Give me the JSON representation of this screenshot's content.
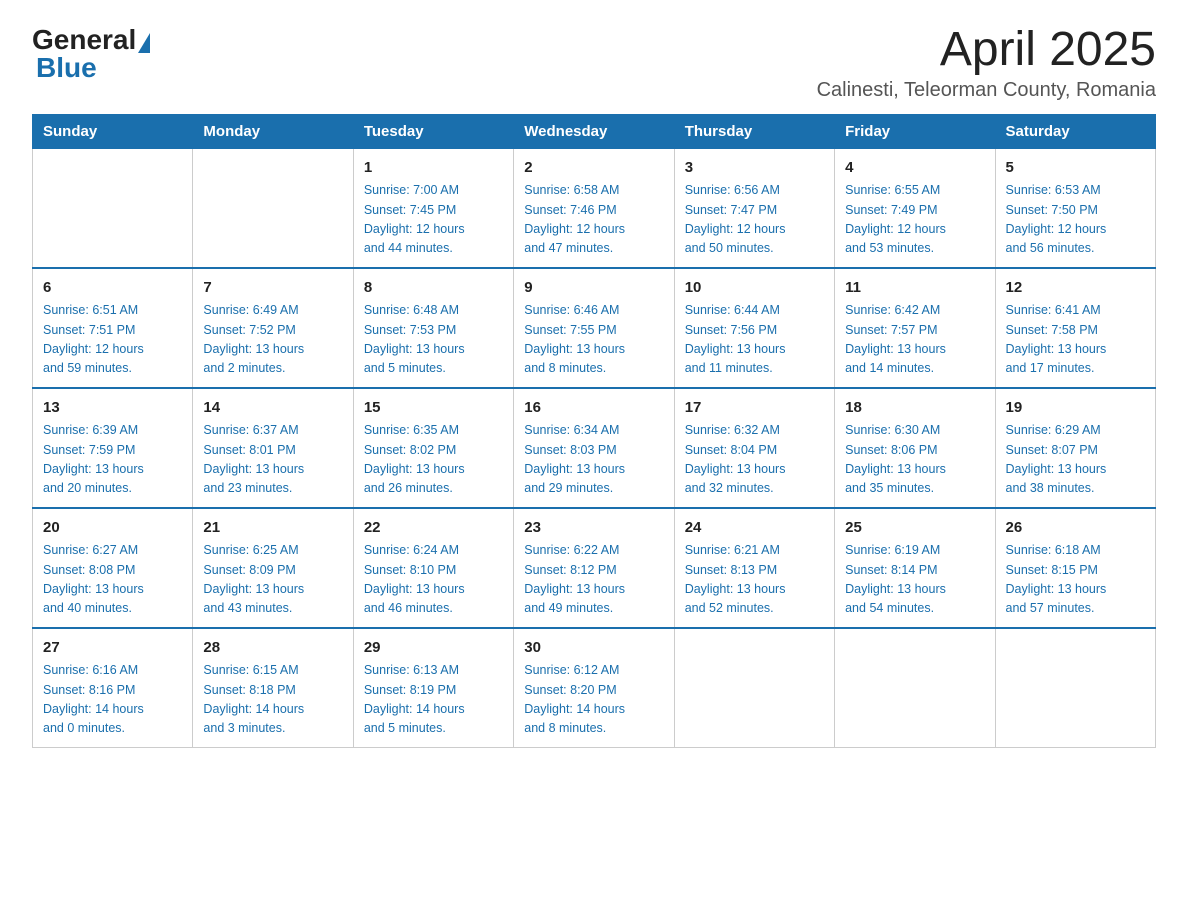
{
  "header": {
    "logo": {
      "text_general": "General",
      "text_blue": "Blue",
      "logo_label": "GeneralBlue"
    },
    "title": "April 2025",
    "subtitle": "Calinesti, Teleorman County, Romania"
  },
  "calendar": {
    "days_of_week": [
      "Sunday",
      "Monday",
      "Tuesday",
      "Wednesday",
      "Thursday",
      "Friday",
      "Saturday"
    ],
    "weeks": [
      {
        "days": [
          {
            "number": "",
            "info": ""
          },
          {
            "number": "",
            "info": ""
          },
          {
            "number": "1",
            "info": "Sunrise: 7:00 AM\nSunset: 7:45 PM\nDaylight: 12 hours\nand 44 minutes."
          },
          {
            "number": "2",
            "info": "Sunrise: 6:58 AM\nSunset: 7:46 PM\nDaylight: 12 hours\nand 47 minutes."
          },
          {
            "number": "3",
            "info": "Sunrise: 6:56 AM\nSunset: 7:47 PM\nDaylight: 12 hours\nand 50 minutes."
          },
          {
            "number": "4",
            "info": "Sunrise: 6:55 AM\nSunset: 7:49 PM\nDaylight: 12 hours\nand 53 minutes."
          },
          {
            "number": "5",
            "info": "Sunrise: 6:53 AM\nSunset: 7:50 PM\nDaylight: 12 hours\nand 56 minutes."
          }
        ]
      },
      {
        "days": [
          {
            "number": "6",
            "info": "Sunrise: 6:51 AM\nSunset: 7:51 PM\nDaylight: 12 hours\nand 59 minutes."
          },
          {
            "number": "7",
            "info": "Sunrise: 6:49 AM\nSunset: 7:52 PM\nDaylight: 13 hours\nand 2 minutes."
          },
          {
            "number": "8",
            "info": "Sunrise: 6:48 AM\nSunset: 7:53 PM\nDaylight: 13 hours\nand 5 minutes."
          },
          {
            "number": "9",
            "info": "Sunrise: 6:46 AM\nSunset: 7:55 PM\nDaylight: 13 hours\nand 8 minutes."
          },
          {
            "number": "10",
            "info": "Sunrise: 6:44 AM\nSunset: 7:56 PM\nDaylight: 13 hours\nand 11 minutes."
          },
          {
            "number": "11",
            "info": "Sunrise: 6:42 AM\nSunset: 7:57 PM\nDaylight: 13 hours\nand 14 minutes."
          },
          {
            "number": "12",
            "info": "Sunrise: 6:41 AM\nSunset: 7:58 PM\nDaylight: 13 hours\nand 17 minutes."
          }
        ]
      },
      {
        "days": [
          {
            "number": "13",
            "info": "Sunrise: 6:39 AM\nSunset: 7:59 PM\nDaylight: 13 hours\nand 20 minutes."
          },
          {
            "number": "14",
            "info": "Sunrise: 6:37 AM\nSunset: 8:01 PM\nDaylight: 13 hours\nand 23 minutes."
          },
          {
            "number": "15",
            "info": "Sunrise: 6:35 AM\nSunset: 8:02 PM\nDaylight: 13 hours\nand 26 minutes."
          },
          {
            "number": "16",
            "info": "Sunrise: 6:34 AM\nSunset: 8:03 PM\nDaylight: 13 hours\nand 29 minutes."
          },
          {
            "number": "17",
            "info": "Sunrise: 6:32 AM\nSunset: 8:04 PM\nDaylight: 13 hours\nand 32 minutes."
          },
          {
            "number": "18",
            "info": "Sunrise: 6:30 AM\nSunset: 8:06 PM\nDaylight: 13 hours\nand 35 minutes."
          },
          {
            "number": "19",
            "info": "Sunrise: 6:29 AM\nSunset: 8:07 PM\nDaylight: 13 hours\nand 38 minutes."
          }
        ]
      },
      {
        "days": [
          {
            "number": "20",
            "info": "Sunrise: 6:27 AM\nSunset: 8:08 PM\nDaylight: 13 hours\nand 40 minutes."
          },
          {
            "number": "21",
            "info": "Sunrise: 6:25 AM\nSunset: 8:09 PM\nDaylight: 13 hours\nand 43 minutes."
          },
          {
            "number": "22",
            "info": "Sunrise: 6:24 AM\nSunset: 8:10 PM\nDaylight: 13 hours\nand 46 minutes."
          },
          {
            "number": "23",
            "info": "Sunrise: 6:22 AM\nSunset: 8:12 PM\nDaylight: 13 hours\nand 49 minutes."
          },
          {
            "number": "24",
            "info": "Sunrise: 6:21 AM\nSunset: 8:13 PM\nDaylight: 13 hours\nand 52 minutes."
          },
          {
            "number": "25",
            "info": "Sunrise: 6:19 AM\nSunset: 8:14 PM\nDaylight: 13 hours\nand 54 minutes."
          },
          {
            "number": "26",
            "info": "Sunrise: 6:18 AM\nSunset: 8:15 PM\nDaylight: 13 hours\nand 57 minutes."
          }
        ]
      },
      {
        "days": [
          {
            "number": "27",
            "info": "Sunrise: 6:16 AM\nSunset: 8:16 PM\nDaylight: 14 hours\nand 0 minutes."
          },
          {
            "number": "28",
            "info": "Sunrise: 6:15 AM\nSunset: 8:18 PM\nDaylight: 14 hours\nand 3 minutes."
          },
          {
            "number": "29",
            "info": "Sunrise: 6:13 AM\nSunset: 8:19 PM\nDaylight: 14 hours\nand 5 minutes."
          },
          {
            "number": "30",
            "info": "Sunrise: 6:12 AM\nSunset: 8:20 PM\nDaylight: 14 hours\nand 8 minutes."
          },
          {
            "number": "",
            "info": ""
          },
          {
            "number": "",
            "info": ""
          },
          {
            "number": "",
            "info": ""
          }
        ]
      }
    ]
  }
}
